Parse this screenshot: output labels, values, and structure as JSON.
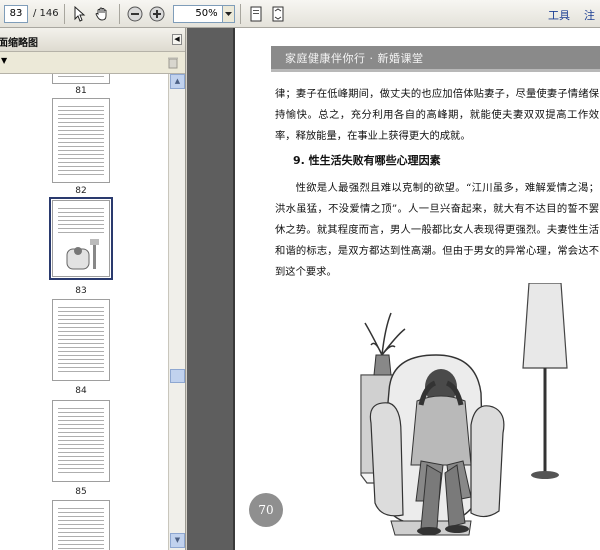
{
  "toolbar": {
    "current_page": "83",
    "page_total": "/ 146",
    "zoom": "50%",
    "tools_label": "工具",
    "comment_label": "注"
  },
  "sidebar": {
    "title": "页面缩略图",
    "options_icon": "options-dropdown-icon",
    "thumbnails": [
      {
        "label": "81"
      },
      {
        "label": "82"
      },
      {
        "label": "83"
      },
      {
        "label": "84"
      },
      {
        "label": "85"
      }
    ]
  },
  "document": {
    "running_header": "家庭健康伴你行 · 新婚课堂",
    "paragraph_1": "律；妻子在低峰期间，做丈夫的也应加倍体贴妻子，尽量使妻子情绪保持愉快。总之，充分利用各自的高峰期，就能使夫妻双双提高工作效率，释放能量，在事业上获得更大的成就。",
    "section_heading": "9. 性生活失败有哪些心理因素",
    "paragraph_2": "性欲是人最强烈且难以克制的欲望。“江川虽多，难解爱情之渴；洪水虽猛，不没爱情之顶”。人一旦兴奋起来，就大有不达目的誓不罢休之势。就其程度而言，男人一般都比女人表现得更强烈。夫妻性生活和谐的标志，是双方都达到性高潮。但由于男女的异常心理，常会达不到这个要求。",
    "page_number": "70"
  },
  "colors": {
    "toolbar_bg": "#e4e2da",
    "sidebar_bg": "#ece9d8",
    "viewer_bg": "#5e5e5e",
    "header_band": "#8a8a8a"
  }
}
